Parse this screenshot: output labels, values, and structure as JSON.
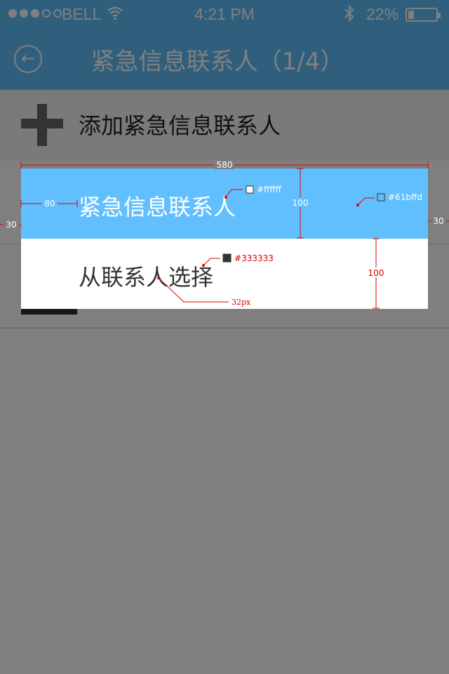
{
  "status_bar": {
    "carrier": "BELL",
    "time": "4:21 PM",
    "battery_percent": "22%",
    "signal_strength": 3,
    "battery_level": 0.22
  },
  "nav": {
    "title": "紧急信息联系人（1/4）",
    "back_icon": "back-arrow-icon"
  },
  "add_row": {
    "label": "添加紧急信息联系人",
    "icon": "plus-icon"
  },
  "action_sheet": {
    "option_1": "紧急信息联系人",
    "option_2": "从联系人选择"
  },
  "annotations": {
    "width": "580",
    "left_indent": "80",
    "row_height_1": "100",
    "row_height_2": "100",
    "margin_left": "30",
    "margin_right": "30",
    "color_white": "#ffffff",
    "color_blue": "#61bffd",
    "color_text": "#333333",
    "font_size": "32px"
  },
  "colors": {
    "accent": "#61bffd",
    "option_text": "#333333",
    "option_text_selected": "#ffffff"
  }
}
